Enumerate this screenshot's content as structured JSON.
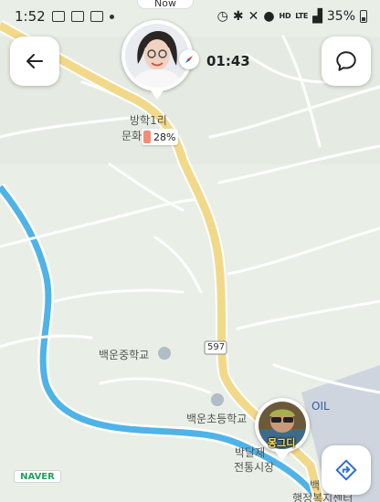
{
  "status_bar": {
    "time": "1:52",
    "battery_percent": "35%",
    "hd_label": "HD",
    "lte_label": "LTE"
  },
  "top_pill": {
    "label": "Now"
  },
  "timer": "01:43",
  "battery_tag": "28%",
  "friend_name": "몽그디",
  "map_labels": {
    "l1": "방학1리",
    "l2": "문화",
    "l3": "백운중학교",
    "l4": "백운초등학교",
    "l5": "박달재",
    "l6": "전통시장",
    "l7": "597",
    "l8": "OIL",
    "l9": "백",
    "l10": "행정복지센터"
  },
  "logo": "NAVER",
  "icons": {
    "back": "back-arrow-icon",
    "chat": "chat-bubble-icon",
    "share": "share-route-icon",
    "compass": "compass-icon"
  },
  "colors": {
    "map_bg": "#e9eee7",
    "road_main": "#f2d98a",
    "river": "#4fb3e8",
    "battery_fill": "#f28c73",
    "naver_green": "#1fa25a"
  }
}
